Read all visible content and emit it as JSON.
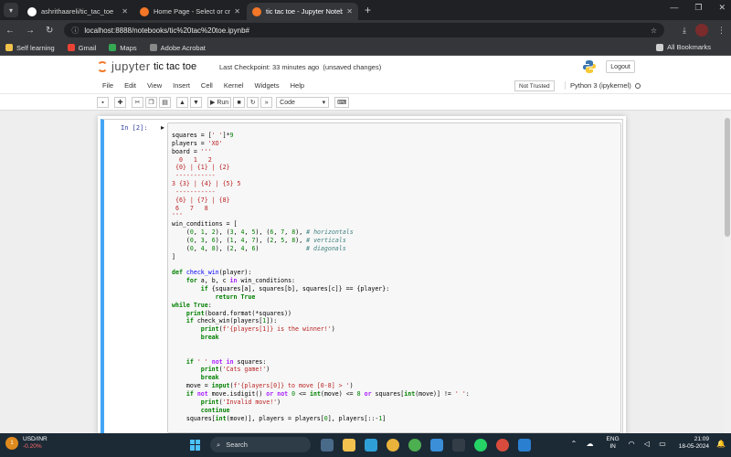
{
  "browser": {
    "tabs": [
      {
        "title": "ashrithaareli/tic_tac_toe",
        "favicon_color": "#ffffff",
        "active": false
      },
      {
        "title": "Home Page - Select or create a",
        "favicon_color": "#f37726",
        "active": false
      },
      {
        "title": "tic tac toe - Jupyter Notebook",
        "favicon_color": "#f37726",
        "active": true
      }
    ],
    "new_tab_label": "+",
    "url": "localhost:8888/notebooks/tic%20tac%20toe.ipynb#",
    "bookmarks": [
      {
        "label": "Self learning",
        "color": "#f0c24b"
      },
      {
        "label": "Gmail",
        "color": "#ea4335"
      },
      {
        "label": "Maps",
        "color": "#34a853"
      },
      {
        "label": "Adobe Acrobat",
        "color": "#888888"
      }
    ],
    "all_bookmarks_label": "All Bookmarks"
  },
  "jupyter": {
    "logo_text": "jupyter",
    "notebook_title": "tic tac toe",
    "checkpoint_text": "Last Checkpoint: 33 minutes ago",
    "unsaved_text": "(unsaved changes)",
    "logout_label": "Logout",
    "menus": [
      "File",
      "Edit",
      "View",
      "Insert",
      "Cell",
      "Kernel",
      "Widgets",
      "Help"
    ],
    "trusted_label": "Not Trusted",
    "kernel_label": "Python 3 (ipykernel)",
    "toolbar": {
      "run_label": "Run",
      "cell_type": "Code"
    },
    "cell": {
      "prompt": "In [2]:"
    }
  },
  "taskbar": {
    "ticker_name": "USD/INR",
    "ticker_change": "-0.20%",
    "search_label": "Search",
    "lang_line1": "ENG",
    "lang_line2": "IN",
    "time": "21:09",
    "date": "18-05-2024"
  },
  "colors": {
    "jupyter_orange": "#f37726",
    "cell_selected": "#42a5f5",
    "taskbar_bg": "#1c2a36"
  }
}
